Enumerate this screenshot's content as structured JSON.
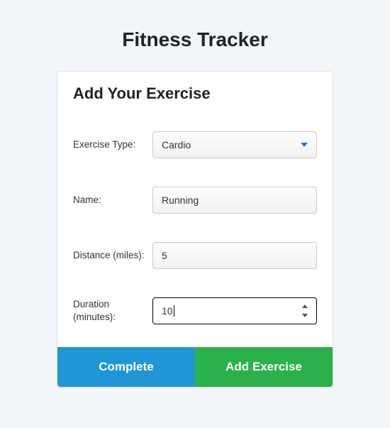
{
  "page": {
    "title": "Fitness Tracker"
  },
  "card": {
    "header": "Add Your Exercise",
    "fields": {
      "type": {
        "label": "Exercise Type:",
        "value": "Cardio"
      },
      "name": {
        "label": "Name:",
        "value": "Running"
      },
      "distance": {
        "label": "Distance (miles):",
        "value": "5"
      },
      "duration": {
        "label": "Duration (minutes):",
        "value": "10"
      }
    },
    "buttons": {
      "complete": "Complete",
      "add": "Add Exercise"
    }
  }
}
